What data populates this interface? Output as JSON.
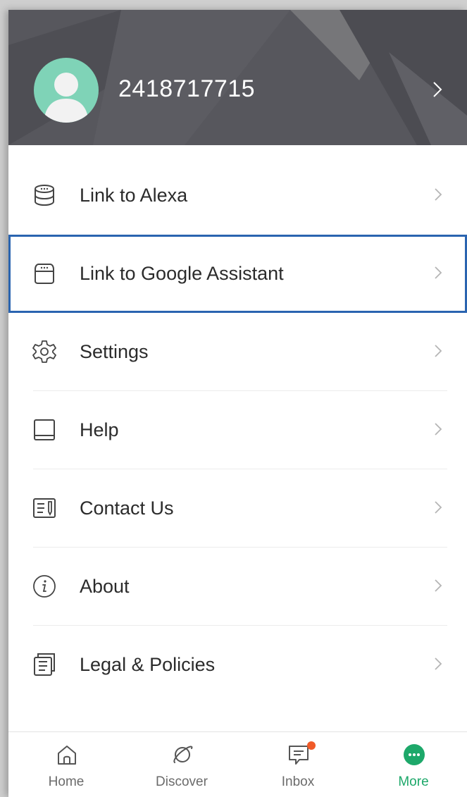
{
  "profile": {
    "username": "2418717715"
  },
  "menu": {
    "items": [
      {
        "label": "Link to Alexa",
        "icon": "alexa-device-icon"
      },
      {
        "label": "Link to Google Assistant",
        "icon": "google-home-device-icon"
      },
      {
        "label": "Settings",
        "icon": "gear-icon"
      },
      {
        "label": "Help",
        "icon": "book-icon"
      },
      {
        "label": "Contact Us",
        "icon": "contact-form-icon"
      },
      {
        "label": "About",
        "icon": "info-icon"
      },
      {
        "label": "Legal & Policies",
        "icon": "document-icon"
      }
    ]
  },
  "bottom_nav": {
    "items": [
      {
        "label": "Home",
        "icon": "home-icon"
      },
      {
        "label": "Discover",
        "icon": "planet-icon"
      },
      {
        "label": "Inbox",
        "icon": "inbox-icon"
      },
      {
        "label": "More",
        "icon": "more-icon"
      }
    ],
    "active": "More"
  },
  "colors": {
    "header_bg": "#5a5a60",
    "accent_green": "#1da86a",
    "highlight_outline": "#2a64b0",
    "badge": "#f05a28",
    "avatar_bg": "#7fd3b7"
  }
}
